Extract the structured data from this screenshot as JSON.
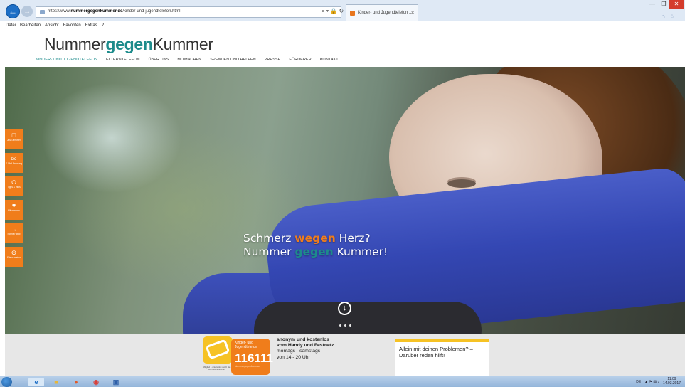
{
  "browser": {
    "url_prefix": "https://www.",
    "url_host": "nummergegenkummer.de",
    "url_path": "/kinder-und-jugendtelefon.html",
    "address_tools": "⌕ ▾ 🔒 ↻",
    "tab_title": "Kinder- und Jugendtelefon ...",
    "menu": [
      "Datei",
      "Bearbeiten",
      "Ansicht",
      "Favoriten",
      "Extras",
      "?"
    ]
  },
  "site": {
    "logo_left": "Nummer",
    "logo_mid": "gegen",
    "logo_right": "Kummer",
    "nav": [
      "KINDER- UND JUGENDTELEFON",
      "ELTERNTELEFON",
      "ÜBER UNS",
      "MITMACHEN",
      "SPENDEN UND HELFEN",
      "PRESSE",
      "FÖRDERER",
      "KONTAKT"
    ]
  },
  "hero": {
    "line1_a": "Schmerz ",
    "line1_b": "wegen",
    "line1_c": " Herz?",
    "line2_a": "Nummer ",
    "line2_b": "gegen",
    "line2_c": " Kummer!"
  },
  "side_actions": [
    {
      "icon": "□",
      "label": "Jetzt anrufen!"
    },
    {
      "icon": "✉",
      "label": "E-Mail Beratung"
    },
    {
      "icon": "⊙",
      "label": "Tipps & Infos"
    },
    {
      "icon": "♥",
      "label": "Mit-machen"
    },
    {
      "icon": "→",
      "label": "Schnell weg!"
    },
    {
      "icon": "⊕",
      "label": "Eltern-telefon"
    }
  ],
  "phone": {
    "line_name": "Kinder- und Jugendtelefon",
    "number": "116111",
    "brand": "Nummergegenkummer",
    "footnote": "Mitglied – unterstützt durch das Bundesministerium",
    "info_line1": "anonym und kostenlos",
    "info_line2": "vom Handy und Festnetz",
    "info_line3": "montags - samstags",
    "info_line4": "von 14 - 20 Uhr"
  },
  "help_card": {
    "text": "Allein mit deinen Problemen? – Darüber reden hilft!"
  },
  "taskbar": {
    "lang": "DE",
    "time": "11:09",
    "date": "14.03.2017"
  },
  "colors": {
    "accent_orange": "#f07d1b",
    "accent_teal": "#1d8b8b",
    "accent_yellow": "#f6c224"
  }
}
